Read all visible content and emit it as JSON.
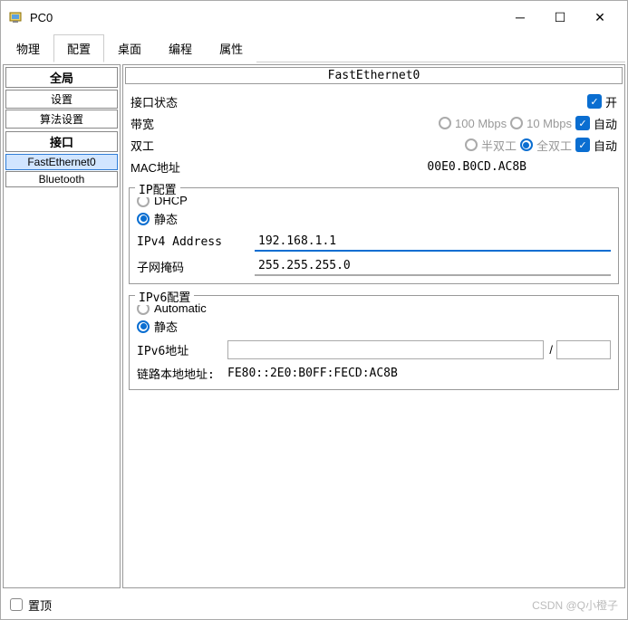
{
  "window": {
    "title": "PC0"
  },
  "tabs": [
    "物理",
    "配置",
    "桌面",
    "编程",
    "属性"
  ],
  "active_tab": "配置",
  "sidebar": {
    "groups": [
      {
        "header": "全局",
        "items": [
          "设置",
          "算法设置"
        ]
      },
      {
        "header": "接口",
        "items": [
          "FastEthernet0",
          "Bluetooth"
        ]
      }
    ],
    "selected": "FastEthernet0"
  },
  "main": {
    "title": "FastEthernet0",
    "port_status": {
      "label": "接口状态",
      "on_label": "开",
      "checked": true
    },
    "bandwidth": {
      "label": "带宽",
      "opt100": "100 Mbps",
      "opt10": "10 Mbps",
      "auto_label": "自动",
      "auto_checked": true
    },
    "duplex": {
      "label": "双工",
      "half": "半双工",
      "full": "全双工",
      "full_selected": true,
      "auto_label": "自动",
      "auto_checked": true
    },
    "mac": {
      "label": "MAC地址",
      "value": "00E0.B0CD.AC8B"
    },
    "ipconf": {
      "legend": "IP配置",
      "dhcp_label": "DHCP",
      "static_label": "静态",
      "mode": "static",
      "ipv4_label": "IPv4 Address",
      "ipv4_value": "192.168.1.1",
      "mask_label": "子网掩码",
      "mask_value": "255.255.255.0"
    },
    "ipv6conf": {
      "legend": "IPv6配置",
      "auto_label": "Automatic",
      "static_label": "静态",
      "mode": "static",
      "ipv6_label": "IPv6地址",
      "ipv6_value": "",
      "linklocal_label": "链路本地地址:",
      "linklocal_value": "FE80::2E0:B0FF:FECD:AC8B"
    }
  },
  "footer": {
    "top_label": "置顶",
    "credit": "CSDN @Q小橙子"
  }
}
